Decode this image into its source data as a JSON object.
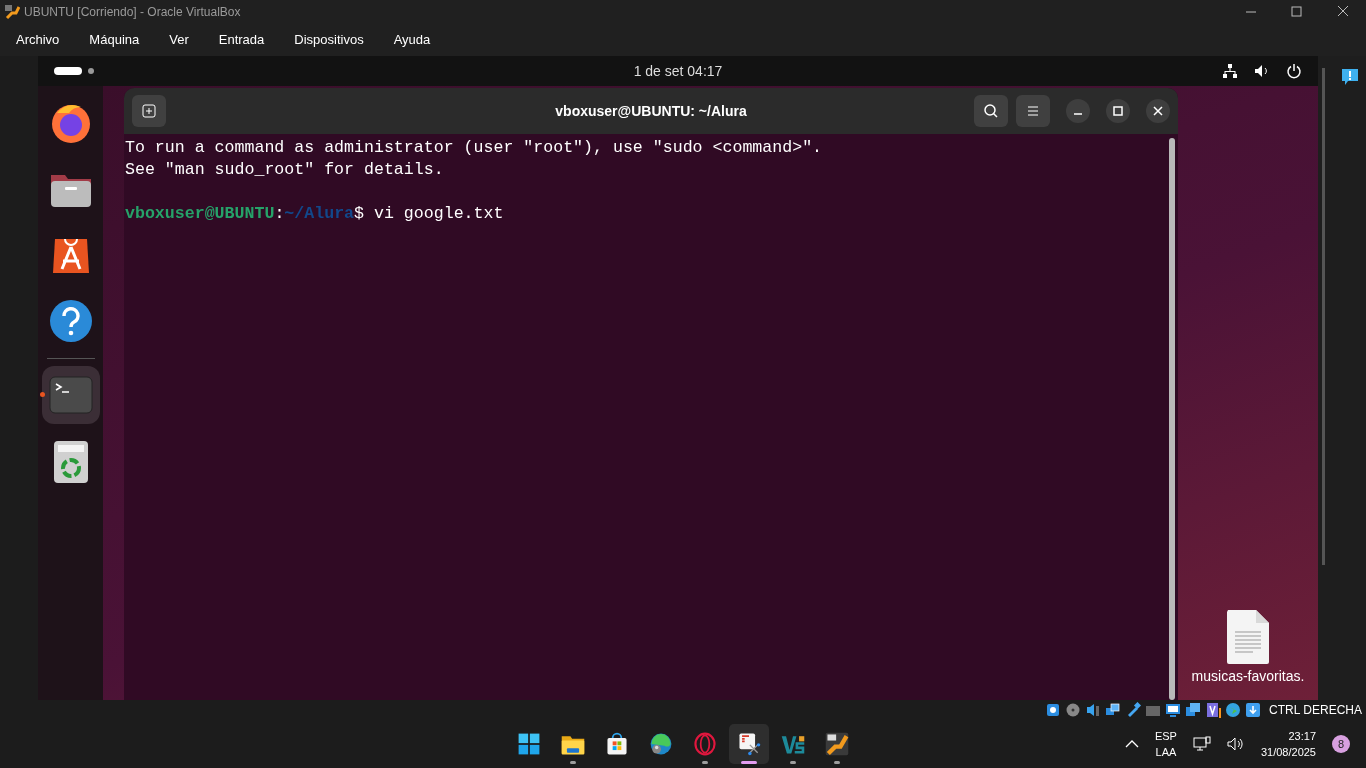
{
  "window": {
    "title": "UBUNTU [Corriendo] - Oracle VirtualBox"
  },
  "menu": [
    "Archivo",
    "Máquina",
    "Ver",
    "Entrada",
    "Dispositivos",
    "Ayuda"
  ],
  "guest": {
    "top_bar": {
      "clock": "1 de set  04:17"
    },
    "dock": [
      {
        "kind": "firefox",
        "selected": false
      },
      {
        "kind": "files",
        "selected": false
      },
      {
        "kind": "appstore",
        "selected": false
      },
      {
        "kind": "help",
        "selected": false
      },
      {
        "kind": "terminal",
        "selected": true
      },
      {
        "kind": "trash",
        "selected": false
      }
    ],
    "terminal": {
      "title": "vboxuser@UBUNTU: ~/Alura",
      "lines": [
        {
          "kind": "text",
          "text": "To run a command as administrator (user \"root\"), use \"sudo <command>\"."
        },
        {
          "kind": "text",
          "text": "See \"man sudo_root\" for details."
        },
        {
          "kind": "blank"
        },
        {
          "kind": "prompt",
          "user": "vboxuser@UBUNTU",
          "separator": ":",
          "path": "~/Alura",
          "command": "$ vi google.txt"
        }
      ]
    },
    "desktop_icons": [
      {
        "label": "musicas-favoritas."
      }
    ]
  },
  "status_bar": {
    "host_key": "CTRL DERECHA"
  },
  "taskbar": {
    "apps": [
      {
        "kind": "start",
        "running": false,
        "selected": false
      },
      {
        "kind": "explorer",
        "running": true,
        "selected": false
      },
      {
        "kind": "store",
        "running": false,
        "selected": false
      },
      {
        "kind": "edge",
        "running": false,
        "selected": false
      },
      {
        "kind": "opera",
        "running": true,
        "selected": false
      },
      {
        "kind": "snip",
        "running": true,
        "selected": true
      },
      {
        "kind": "vs",
        "running": true,
        "selected": false
      },
      {
        "kind": "vbox",
        "running": true,
        "selected": false
      }
    ],
    "language": [
      "ESP",
      "LAA"
    ],
    "time": "23:17",
    "date": "31/08/2025",
    "notifications": "8"
  }
}
